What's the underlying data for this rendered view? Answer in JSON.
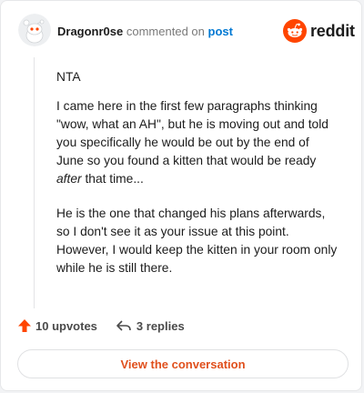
{
  "header": {
    "username": "Dragonr0se",
    "action_text": "commented on",
    "post_link": "post"
  },
  "brand": {
    "wordmark": "reddit",
    "accent_color": "#ff4500"
  },
  "comment": {
    "line1": "NTA",
    "para1_before": "I came here in the first few paragraphs thinking \"wow, what an AH\", but he is moving out and told you specifically he would be out by the end of June so you found a kitten that would be ready ",
    "para1_italic": "after",
    "para1_after": " that time...",
    "para2": "He is the one that changed his plans afterwards, so I don't see it as your issue at this point. However, I would keep the kitten in your room only while he is still there."
  },
  "footer": {
    "upvotes": "10 upvotes",
    "replies": "3 replies",
    "upvote_icon": "upvote-arrow-icon",
    "reply_icon": "reply-arrow-icon"
  },
  "cta": {
    "label": "View the conversation"
  }
}
